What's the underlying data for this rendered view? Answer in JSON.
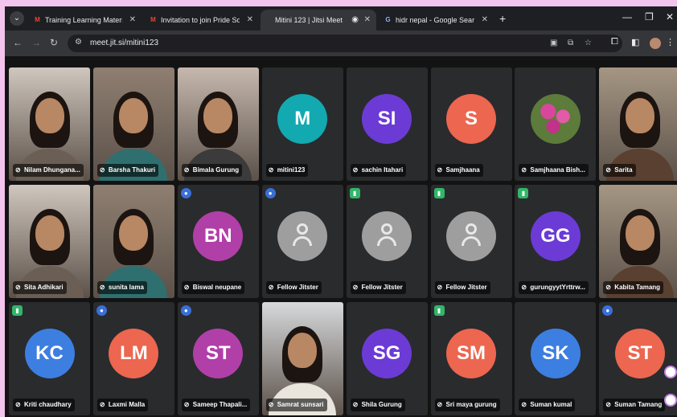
{
  "tabs": [
    {
      "title": "Training Learning Materials & F",
      "favicon": "gmail-icon",
      "active": false
    },
    {
      "title": "Invitation to join Pride Social Eve",
      "favicon": "gmail-icon",
      "active": false
    },
    {
      "title": "Mitini 123 | Jitsi Meet",
      "favicon": "record-icon",
      "active": true
    },
    {
      "title": "hidr nepal - Google Search",
      "favicon": "google-icon",
      "active": false
    }
  ],
  "toolbar": {
    "url": "meet.jit.si/mitini123"
  },
  "participants": [
    {
      "name": "Nilam Dhungana...",
      "kind": "video"
    },
    {
      "name": "Barsha Thakuri",
      "kind": "video"
    },
    {
      "name": "Bimala Gurung",
      "kind": "video"
    },
    {
      "name": "mitini123",
      "kind": "initials",
      "initials": "M",
      "color": "#12a9b1"
    },
    {
      "name": "sachin Itahari",
      "kind": "initials",
      "initials": "SI",
      "color": "#6c3bd6"
    },
    {
      "name": "Samjhaana",
      "kind": "initials",
      "initials": "S",
      "color": "#ec6650"
    },
    {
      "name": "Samjhaana Bish...",
      "kind": "flower"
    },
    {
      "name": "Sarita",
      "kind": "video",
      "speaker": true
    },
    {
      "name": "Sita Adhikari",
      "kind": "video"
    },
    {
      "name": "sunita lama",
      "kind": "video"
    },
    {
      "name": "Biswal neupane",
      "kind": "initials",
      "initials": "BN",
      "color": "#b13fa8",
      "badge": "mod"
    },
    {
      "name": "Fellow Jitster",
      "kind": "generic",
      "badge": "mod"
    },
    {
      "name": "Fellow Jitster",
      "kind": "generic",
      "badge": "conn"
    },
    {
      "name": "Fellow Jitster",
      "kind": "generic",
      "badge": "conn"
    },
    {
      "name": "gurungyytYrttrw...",
      "kind": "initials",
      "initials": "GG",
      "color": "#6c3bd6",
      "badge": "conn"
    },
    {
      "name": "Kabita Tamang",
      "kind": "video"
    },
    {
      "name": "Kriti chaudhary",
      "kind": "initials",
      "initials": "KC",
      "color": "#3d7ee1",
      "badge": "conn"
    },
    {
      "name": "Laxmi Malla",
      "kind": "initials",
      "initials": "LM",
      "color": "#ec6650",
      "badge": "mod"
    },
    {
      "name": "Sameep Thapali...",
      "kind": "initials",
      "initials": "ST",
      "color": "#b13fa8",
      "badge": "mod"
    },
    {
      "name": "Samrat sunsari",
      "kind": "video"
    },
    {
      "name": "Shila Gurung",
      "kind": "initials",
      "initials": "SG",
      "color": "#6c3bd6"
    },
    {
      "name": "Sri maya gurung",
      "kind": "initials",
      "initials": "SM",
      "color": "#ec6650",
      "badge": "conn"
    },
    {
      "name": "Suman kumal",
      "kind": "initials",
      "initials": "SK",
      "color": "#3d7ee1"
    },
    {
      "name": "Suman Tamang",
      "kind": "initials",
      "initials": "ST",
      "color": "#ec6650",
      "badge": "mod"
    }
  ]
}
